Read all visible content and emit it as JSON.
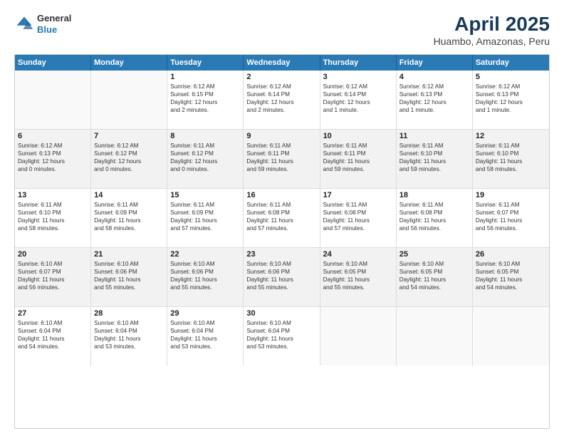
{
  "header": {
    "logo_general": "General",
    "logo_blue": "Blue",
    "title": "April 2025",
    "subtitle": "Huambo, Amazonas, Peru"
  },
  "calendar": {
    "days_of_week": [
      "Sunday",
      "Monday",
      "Tuesday",
      "Wednesday",
      "Thursday",
      "Friday",
      "Saturday"
    ],
    "weeks": [
      [
        {
          "day": "",
          "lines": [],
          "empty": true
        },
        {
          "day": "",
          "lines": [],
          "empty": true
        },
        {
          "day": "1",
          "lines": [
            "Sunrise: 6:12 AM",
            "Sunset: 6:15 PM",
            "Daylight: 12 hours",
            "and 2 minutes."
          ]
        },
        {
          "day": "2",
          "lines": [
            "Sunrise: 6:12 AM",
            "Sunset: 6:14 PM",
            "Daylight: 12 hours",
            "and 2 minutes."
          ]
        },
        {
          "day": "3",
          "lines": [
            "Sunrise: 6:12 AM",
            "Sunset: 6:14 PM",
            "Daylight: 12 hours",
            "and 1 minute."
          ]
        },
        {
          "day": "4",
          "lines": [
            "Sunrise: 6:12 AM",
            "Sunset: 6:13 PM",
            "Daylight: 12 hours",
            "and 1 minute."
          ]
        },
        {
          "day": "5",
          "lines": [
            "Sunrise: 6:12 AM",
            "Sunset: 6:13 PM",
            "Daylight: 12 hours",
            "and 1 minute."
          ]
        }
      ],
      [
        {
          "day": "6",
          "lines": [
            "Sunrise: 6:12 AM",
            "Sunset: 6:13 PM",
            "Daylight: 12 hours",
            "and 0 minutes."
          ]
        },
        {
          "day": "7",
          "lines": [
            "Sunrise: 6:12 AM",
            "Sunset: 6:12 PM",
            "Daylight: 12 hours",
            "and 0 minutes."
          ]
        },
        {
          "day": "8",
          "lines": [
            "Sunrise: 6:11 AM",
            "Sunset: 6:12 PM",
            "Daylight: 12 hours",
            "and 0 minutes."
          ]
        },
        {
          "day": "9",
          "lines": [
            "Sunrise: 6:11 AM",
            "Sunset: 6:11 PM",
            "Daylight: 11 hours",
            "and 59 minutes."
          ]
        },
        {
          "day": "10",
          "lines": [
            "Sunrise: 6:11 AM",
            "Sunset: 6:11 PM",
            "Daylight: 11 hours",
            "and 59 minutes."
          ]
        },
        {
          "day": "11",
          "lines": [
            "Sunrise: 6:11 AM",
            "Sunset: 6:10 PM",
            "Daylight: 11 hours",
            "and 59 minutes."
          ]
        },
        {
          "day": "12",
          "lines": [
            "Sunrise: 6:11 AM",
            "Sunset: 6:10 PM",
            "Daylight: 11 hours",
            "and 58 minutes."
          ]
        }
      ],
      [
        {
          "day": "13",
          "lines": [
            "Sunrise: 6:11 AM",
            "Sunset: 6:10 PM",
            "Daylight: 11 hours",
            "and 58 minutes."
          ]
        },
        {
          "day": "14",
          "lines": [
            "Sunrise: 6:11 AM",
            "Sunset: 6:09 PM",
            "Daylight: 11 hours",
            "and 58 minutes."
          ]
        },
        {
          "day": "15",
          "lines": [
            "Sunrise: 6:11 AM",
            "Sunset: 6:09 PM",
            "Daylight: 11 hours",
            "and 57 minutes."
          ]
        },
        {
          "day": "16",
          "lines": [
            "Sunrise: 6:11 AM",
            "Sunset: 6:08 PM",
            "Daylight: 11 hours",
            "and 57 minutes."
          ]
        },
        {
          "day": "17",
          "lines": [
            "Sunrise: 6:11 AM",
            "Sunset: 6:08 PM",
            "Daylight: 11 hours",
            "and 57 minutes."
          ]
        },
        {
          "day": "18",
          "lines": [
            "Sunrise: 6:11 AM",
            "Sunset: 6:08 PM",
            "Daylight: 11 hours",
            "and 56 minutes."
          ]
        },
        {
          "day": "19",
          "lines": [
            "Sunrise: 6:11 AM",
            "Sunset: 6:07 PM",
            "Daylight: 11 hours",
            "and 56 minutes."
          ]
        }
      ],
      [
        {
          "day": "20",
          "lines": [
            "Sunrise: 6:10 AM",
            "Sunset: 6:07 PM",
            "Daylight: 11 hours",
            "and 56 minutes."
          ]
        },
        {
          "day": "21",
          "lines": [
            "Sunrise: 6:10 AM",
            "Sunset: 6:06 PM",
            "Daylight: 11 hours",
            "and 55 minutes."
          ]
        },
        {
          "day": "22",
          "lines": [
            "Sunrise: 6:10 AM",
            "Sunset: 6:06 PM",
            "Daylight: 11 hours",
            "and 55 minutes."
          ]
        },
        {
          "day": "23",
          "lines": [
            "Sunrise: 6:10 AM",
            "Sunset: 6:06 PM",
            "Daylight: 11 hours",
            "and 55 minutes."
          ]
        },
        {
          "day": "24",
          "lines": [
            "Sunrise: 6:10 AM",
            "Sunset: 6:05 PM",
            "Daylight: 11 hours",
            "and 55 minutes."
          ]
        },
        {
          "day": "25",
          "lines": [
            "Sunrise: 6:10 AM",
            "Sunset: 6:05 PM",
            "Daylight: 11 hours",
            "and 54 minutes."
          ]
        },
        {
          "day": "26",
          "lines": [
            "Sunrise: 6:10 AM",
            "Sunset: 6:05 PM",
            "Daylight: 11 hours",
            "and 54 minutes."
          ]
        }
      ],
      [
        {
          "day": "27",
          "lines": [
            "Sunrise: 6:10 AM",
            "Sunset: 6:04 PM",
            "Daylight: 11 hours",
            "and 54 minutes."
          ]
        },
        {
          "day": "28",
          "lines": [
            "Sunrise: 6:10 AM",
            "Sunset: 6:04 PM",
            "Daylight: 11 hours",
            "and 53 minutes."
          ]
        },
        {
          "day": "29",
          "lines": [
            "Sunrise: 6:10 AM",
            "Sunset: 6:04 PM",
            "Daylight: 11 hours",
            "and 53 minutes."
          ]
        },
        {
          "day": "30",
          "lines": [
            "Sunrise: 6:10 AM",
            "Sunset: 6:04 PM",
            "Daylight: 11 hours",
            "and 53 minutes."
          ]
        },
        {
          "day": "",
          "lines": [],
          "empty": true
        },
        {
          "day": "",
          "lines": [],
          "empty": true
        },
        {
          "day": "",
          "lines": [],
          "empty": true
        }
      ]
    ]
  }
}
